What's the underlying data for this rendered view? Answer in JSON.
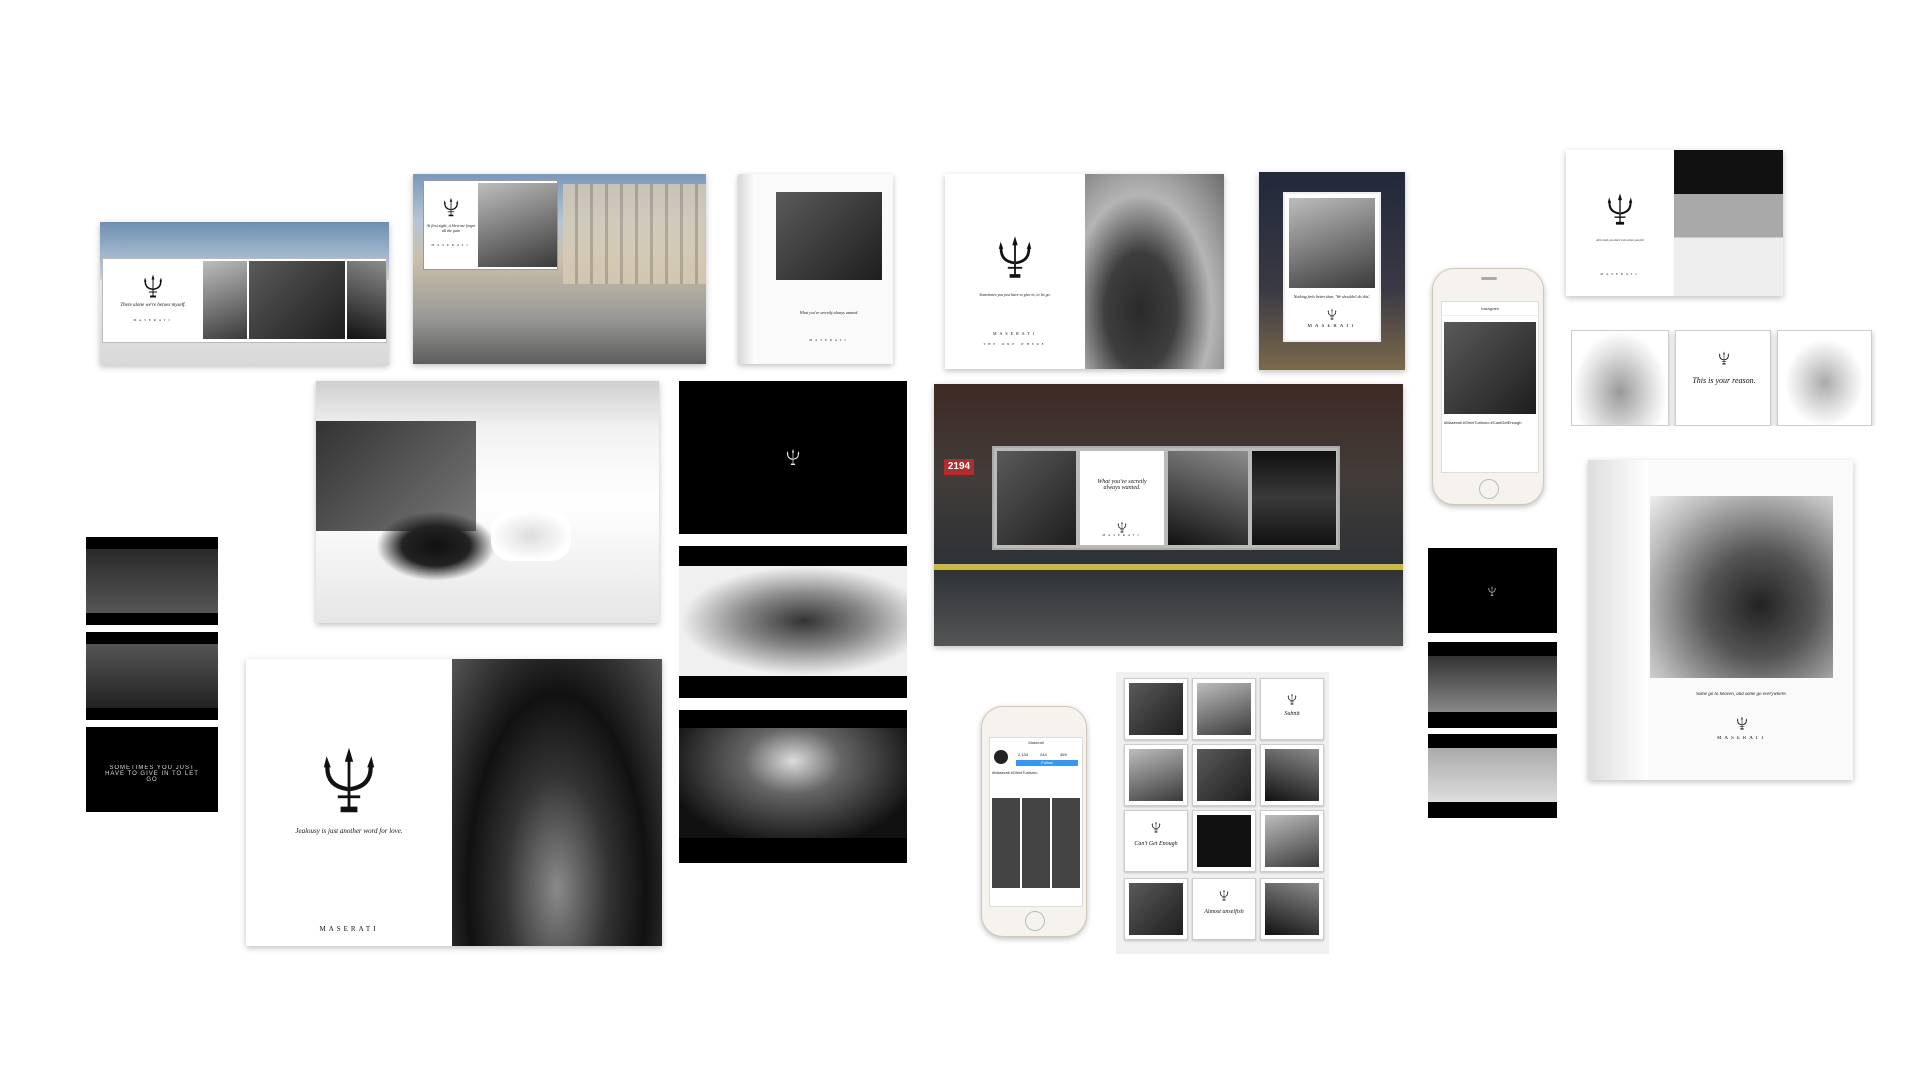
{
  "brand": {
    "name": "MASERATI"
  },
  "billboard_street": {
    "tagline": "There alone we're heroes myself."
  },
  "billboard_paris": {
    "tagline": "At first sight, it blew me forget all the pain"
  },
  "magazine_drive": {
    "tagline": "What you've secretly always wanted."
  },
  "spread_grille": {
    "tagline": "Sometimes you just have to give in, to let go.",
    "footer": "THE ONE WHERE"
  },
  "poster_group": {
    "tagline": "Nothing feels better than, 'We shouldn't do this'."
  },
  "spread_beach": {
    "tagline": "All in bed, you don't even when you feel"
  },
  "reason_strip": {
    "tagline": "This is your reason."
  },
  "subway": {
    "train_number": "2194",
    "tagline": "What you've secretly always wanted."
  },
  "film_left": {
    "caption": "SOMETIMES YOU JUST HAVE TO GIVE IN TO LET GO"
  },
  "spread_keys": {
    "tagline": "Jealousy is just another word for love."
  },
  "magazine_right": {
    "tagline": "Some go to heaven, and some go everywhere."
  },
  "phone_top": {
    "hashtags": "#Maserati #GhiniTuriismo #CantGetEnough"
  },
  "phone_bottom": {
    "profile": "Maserati",
    "hashtag": "#Maserati #GhiniTuriismo",
    "stat1": "2,134",
    "stat2": "244",
    "stat3": "459",
    "follow": "Follow"
  },
  "grid": {
    "subnit": "Subnit",
    "cant": "Can't Get Enough",
    "almost": "Almost unselfish"
  }
}
